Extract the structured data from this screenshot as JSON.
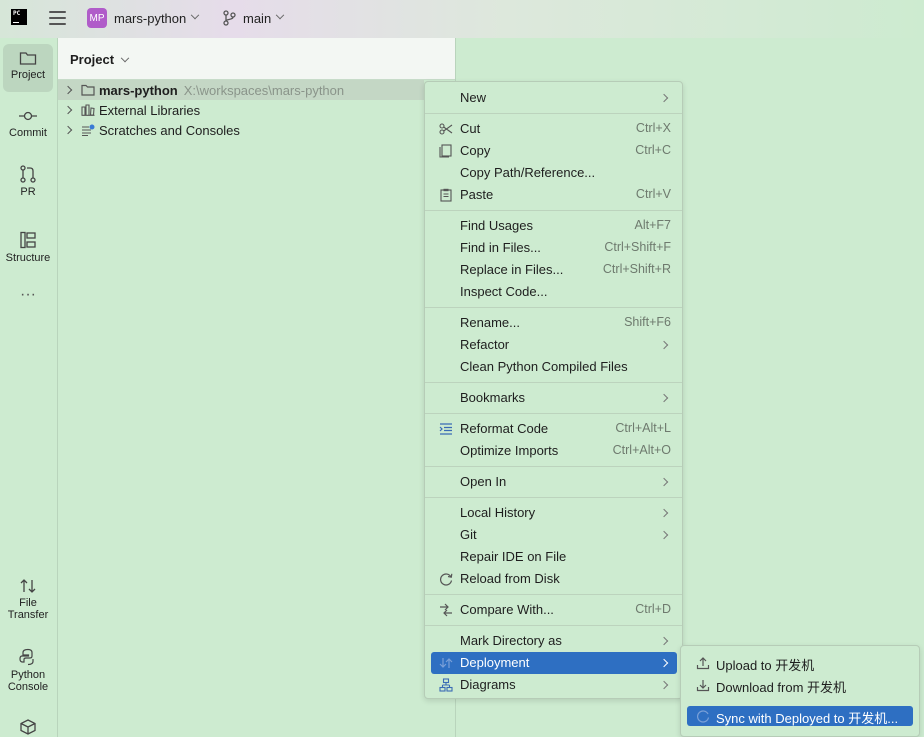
{
  "titlebar": {
    "logo_text": "PC",
    "project_badge": "MP",
    "project_name": "mars-python",
    "branch_name": "main"
  },
  "toolstrip": {
    "top": [
      {
        "label": "Project",
        "icon": "folder-icon"
      },
      {
        "label": "Commit",
        "icon": "commit-icon"
      },
      {
        "label": "PR",
        "icon": "pull-request-icon"
      },
      {
        "label": "Structure",
        "icon": "structure-icon"
      },
      {
        "label": "",
        "icon": "more-icon"
      }
    ],
    "bottom": [
      {
        "label_1": "File",
        "label_2": "Transfer",
        "icon": "file-transfer-icon"
      },
      {
        "label_1": "Python",
        "label_2": "Console",
        "icon": "python-console-icon"
      }
    ]
  },
  "project_panel": {
    "title": "Project",
    "tree": [
      {
        "label": "mars-python",
        "path": "X:\\workspaces\\mars-python",
        "icon": "folder-icon"
      },
      {
        "label": "External Libraries",
        "icon": "libraries-icon"
      },
      {
        "label": "Scratches and Consoles",
        "icon": "scratches-icon"
      }
    ]
  },
  "context_menu": {
    "new": "New",
    "cut": "Cut",
    "cut_sc": "Ctrl+X",
    "copy": "Copy",
    "copy_sc": "Ctrl+C",
    "copy_path": "Copy Path/Reference...",
    "paste": "Paste",
    "paste_sc": "Ctrl+V",
    "find_usages": "Find Usages",
    "find_usages_sc": "Alt+F7",
    "find_in_files": "Find in Files...",
    "find_in_files_sc": "Ctrl+Shift+F",
    "replace_in_files": "Replace in Files...",
    "replace_in_files_sc": "Ctrl+Shift+R",
    "inspect_code": "Inspect Code...",
    "rename": "Rename...",
    "rename_sc": "Shift+F6",
    "refactor": "Refactor",
    "clean_python": "Clean Python Compiled Files",
    "bookmarks": "Bookmarks",
    "reformat": "Reformat Code",
    "reformat_sc": "Ctrl+Alt+L",
    "optimize_imports": "Optimize Imports",
    "optimize_imports_sc": "Ctrl+Alt+O",
    "open_in": "Open In",
    "local_history": "Local History",
    "git": "Git",
    "repair_ide": "Repair IDE on File",
    "reload": "Reload from Disk",
    "compare_with": "Compare With...",
    "compare_with_sc": "Ctrl+D",
    "mark_directory": "Mark Directory as",
    "deployment": "Deployment",
    "diagrams": "Diagrams"
  },
  "submenu": {
    "upload": "Upload to 开发机",
    "download": "Download from 开发机",
    "sync": "Sync with Deployed to 开发机..."
  },
  "colors": {
    "background": "#cdebd0",
    "highlight": "#2e6fc2",
    "project_badge": "#b05cc9"
  }
}
